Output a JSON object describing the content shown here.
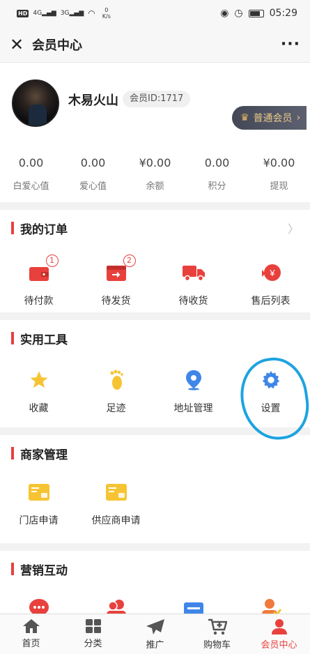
{
  "status_bar": {
    "hd": "HD",
    "signal_1": "4G",
    "signal_2": "3G",
    "speed_value": "0",
    "speed_unit": "K/s",
    "time": "05:29"
  },
  "title_bar": {
    "title": "会员中心"
  },
  "profile": {
    "username": "木易火山",
    "member_id": "会员ID:1717",
    "level": "普通会员"
  },
  "stats": [
    {
      "value": "0.00",
      "label": "白爱心值"
    },
    {
      "value": "0.00",
      "label": "爱心值"
    },
    {
      "value": "¥0.00",
      "label": "余额"
    },
    {
      "value": "0.00",
      "label": "积分"
    },
    {
      "value": "¥0.00",
      "label": "提现"
    }
  ],
  "orders": {
    "title": "我的订单",
    "items": [
      {
        "label": "待付款",
        "icon": "wallet-icon",
        "badge": "1"
      },
      {
        "label": "待发货",
        "icon": "outbox-icon",
        "badge": "2"
      },
      {
        "label": "待收货",
        "icon": "truck-icon"
      },
      {
        "label": "售后列表",
        "icon": "refund-icon"
      }
    ]
  },
  "tools": {
    "title": "实用工具",
    "items": [
      {
        "label": "收藏",
        "icon": "star-icon"
      },
      {
        "label": "足迹",
        "icon": "footprint-icon"
      },
      {
        "label": "地址管理",
        "icon": "location-pin-icon"
      },
      {
        "label": "设置",
        "icon": "gear-icon"
      }
    ]
  },
  "merchant": {
    "title": "商家管理",
    "items": [
      {
        "label": "门店申请",
        "icon": "store-card-icon"
      },
      {
        "label": "供应商申请",
        "icon": "supplier-card-icon"
      }
    ]
  },
  "marketing": {
    "title": "营销互动"
  },
  "tabbar": [
    {
      "label": "首页",
      "icon": "home-icon"
    },
    {
      "label": "分类",
      "icon": "grid-icon"
    },
    {
      "label": "推广",
      "icon": "paper-plane-icon"
    },
    {
      "label": "购物车",
      "icon": "cart-icon"
    },
    {
      "label": "会员中心",
      "icon": "user-icon",
      "active": true
    }
  ],
  "colors": {
    "accent_red": "#e8413d",
    "icon_yellow": "#f6c433",
    "icon_blue": "#3f86e8",
    "annotation_blue": "#1ea3e0"
  }
}
